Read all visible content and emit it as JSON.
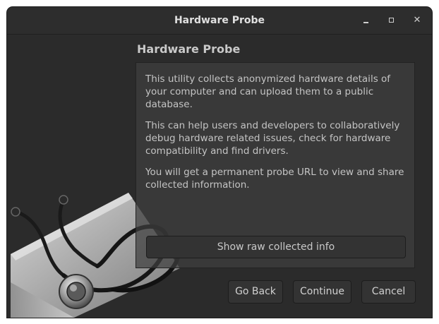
{
  "window": {
    "title": "Hardware Probe",
    "controls": [
      "minimize",
      "maximize",
      "close"
    ]
  },
  "icons": {
    "minimize": "minimize-icon",
    "maximize": "maximize-icon",
    "close": "close-icon",
    "illustration": "stethoscope-laptop-icon"
  },
  "main": {
    "heading": "Hardware Probe",
    "paragraphs": [
      "This utility collects anonymized hardware details of your computer and can upload them to a public database.",
      "This can help users and developers to collaboratively debug hardware related issues, check for hardware compatibility and find drivers.",
      "You will get a permanent probe URL to view and share collected information."
    ],
    "raw_button": "Show raw collected info"
  },
  "footer": {
    "back": "Go Back",
    "continue": "Continue",
    "cancel": "Cancel"
  },
  "colors": {
    "window_bg": "#2b2b2b",
    "panel_bg": "#3e3e3e",
    "text": "#c4c4c4"
  }
}
